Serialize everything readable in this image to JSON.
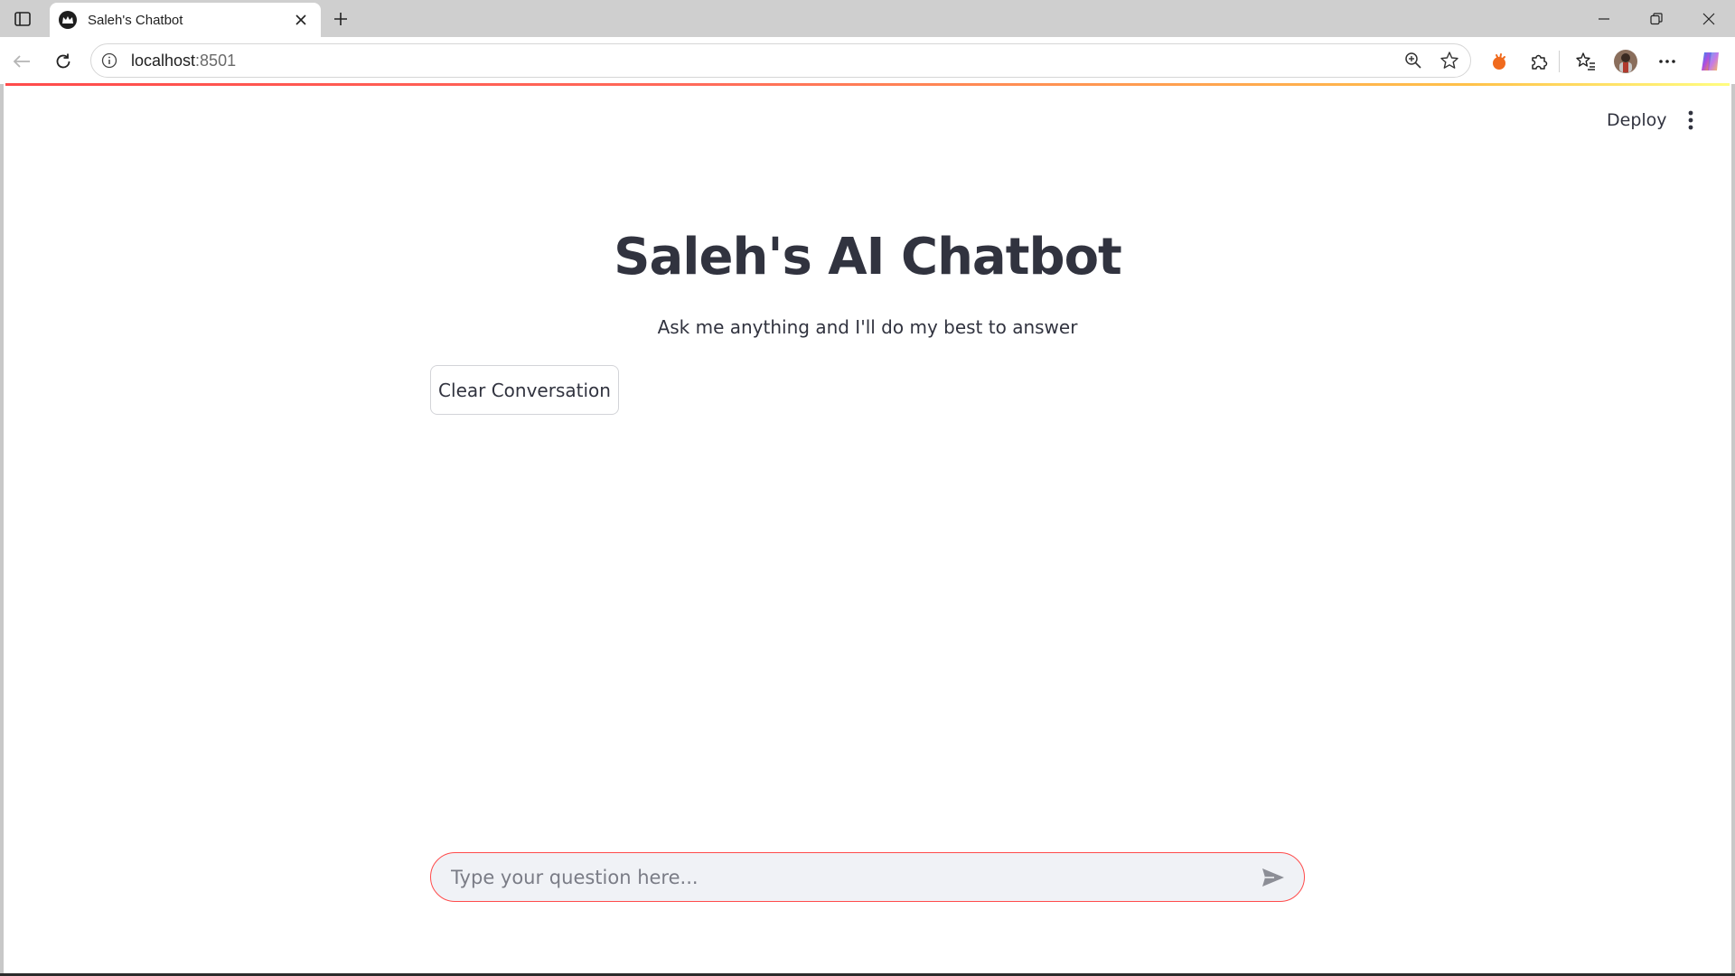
{
  "browser": {
    "tab_title": "Saleh's Chatbot",
    "url_host": "localhost",
    "url_port": ":8501",
    "icons": {
      "sidebar": "tab-sidebar-icon",
      "close": "close-icon",
      "new_tab": "plus-icon",
      "back": "back-arrow-icon",
      "reload": "reload-icon",
      "info": "info-icon",
      "zoom": "zoom-icon",
      "favorite": "star-icon",
      "extensions": "puzzle-icon",
      "favorites_bar": "favorites-icon",
      "profile": "profile-avatar",
      "more": "more-icon",
      "copilot": "copilot-icon"
    }
  },
  "app": {
    "deploy_label": "Deploy",
    "title": "Saleh's AI Chatbot",
    "subtitle": "Ask me anything and I'll do my best to answer",
    "clear_button": "Clear Conversation",
    "chat_placeholder": "Type your question here...",
    "chat_value": "",
    "accent_color": "#ff4b4b",
    "text_color": "#31333f"
  }
}
